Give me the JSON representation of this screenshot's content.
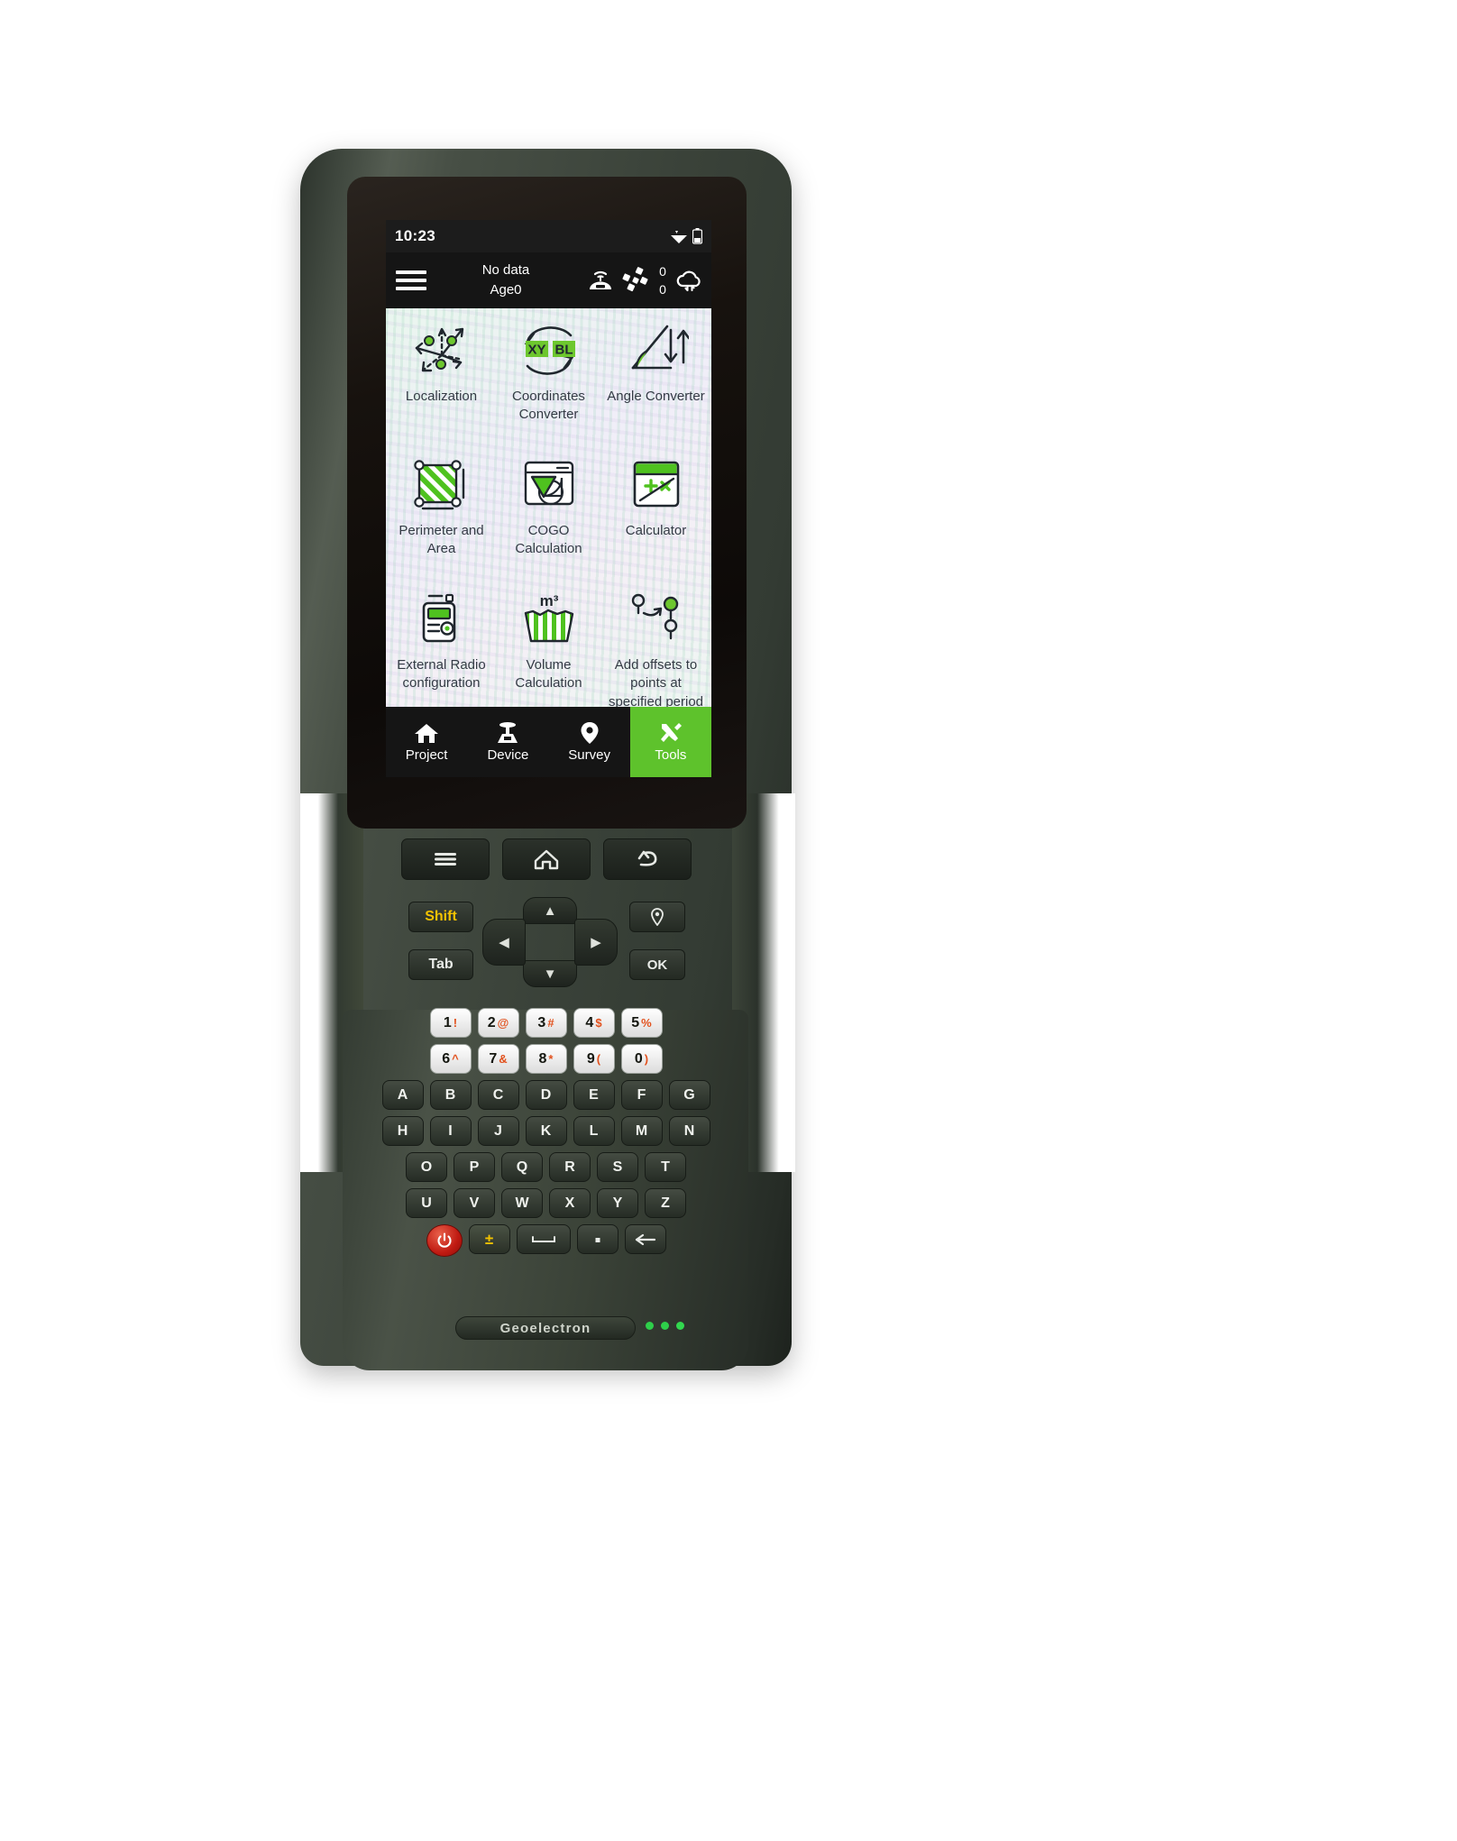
{
  "device": {
    "brand": "Geoelectron",
    "leds": [
      "#2ecf4a",
      "#2ecf4a",
      "#32d84f"
    ]
  },
  "screen": {
    "status_bar": {
      "time": "10:23",
      "icons": [
        "wifi-icon",
        "battery-icon"
      ]
    },
    "app_bar": {
      "menu_icon": "hamburger-icon",
      "diff_status": "No data",
      "age": "Age0",
      "base_icon": "base-station-icon",
      "satellite_icon": "satellite-icon",
      "sat_count_top": "0",
      "sat_count_bottom": "0",
      "cloud_icon": "cloud-sync-icon"
    },
    "tools": [
      {
        "label": "Localization",
        "icon": "localization-icon"
      },
      {
        "label": "Coordinates Converter",
        "icon": "coordinates-converter-icon"
      },
      {
        "label": "Angle Converter",
        "icon": "angle-converter-icon"
      },
      {
        "label": "Perimeter and Area",
        "icon": "perimeter-area-icon"
      },
      {
        "label": "COGO Calculation",
        "icon": "cogo-calculation-icon"
      },
      {
        "label": "Calculator",
        "icon": "calculator-icon"
      },
      {
        "label": "External Radio configuration",
        "icon": "external-radio-icon"
      },
      {
        "label": "Volume Calculation",
        "icon": "volume-calculation-icon"
      },
      {
        "label": "Add offsets to points at specified period",
        "icon": "add-offsets-icon"
      }
    ],
    "tabs": [
      {
        "label": "Project",
        "icon": "home-icon",
        "active": false
      },
      {
        "label": "Device",
        "icon": "receiver-icon",
        "active": false
      },
      {
        "label": "Survey",
        "icon": "location-pin-icon",
        "active": false
      },
      {
        "label": "Tools",
        "icon": "tools-icon",
        "active": true
      }
    ],
    "accent_color": "#5ec22c"
  },
  "keypad": {
    "function_row": [
      "menu-key",
      "home-key",
      "back-key"
    ],
    "shift": "Shift",
    "tab": "Tab",
    "pin": "pin-key",
    "ok": "OK",
    "dpad": [
      "up",
      "down",
      "left",
      "right"
    ],
    "num_row_1": [
      {
        "n": "1",
        "alt": "!"
      },
      {
        "n": "2",
        "alt": "@"
      },
      {
        "n": "3",
        "alt": "#"
      },
      {
        "n": "4",
        "alt": "$"
      },
      {
        "n": "5",
        "alt": "%"
      }
    ],
    "num_row_2": [
      {
        "n": "6",
        "alt": "^"
      },
      {
        "n": "7",
        "alt": "&"
      },
      {
        "n": "8",
        "alt": "*"
      },
      {
        "n": "9",
        "alt": "("
      },
      {
        "n": "0",
        "alt": ")"
      }
    ],
    "alpha_row_1": [
      "A",
      "B",
      "C",
      "D",
      "E",
      "F",
      "G"
    ],
    "alpha_row_2": [
      "H",
      "I",
      "J",
      "K",
      "L",
      "M",
      "N"
    ],
    "alpha_row_3": [
      "O",
      "P",
      "Q",
      "R",
      "S",
      "T"
    ],
    "alpha_row_4": [
      "U",
      "V",
      "W",
      "X",
      "Y",
      "Z"
    ],
    "bottom_row": [
      "power-key",
      "plus-key",
      "space-key",
      "dot-key",
      "backspace-key"
    ]
  }
}
